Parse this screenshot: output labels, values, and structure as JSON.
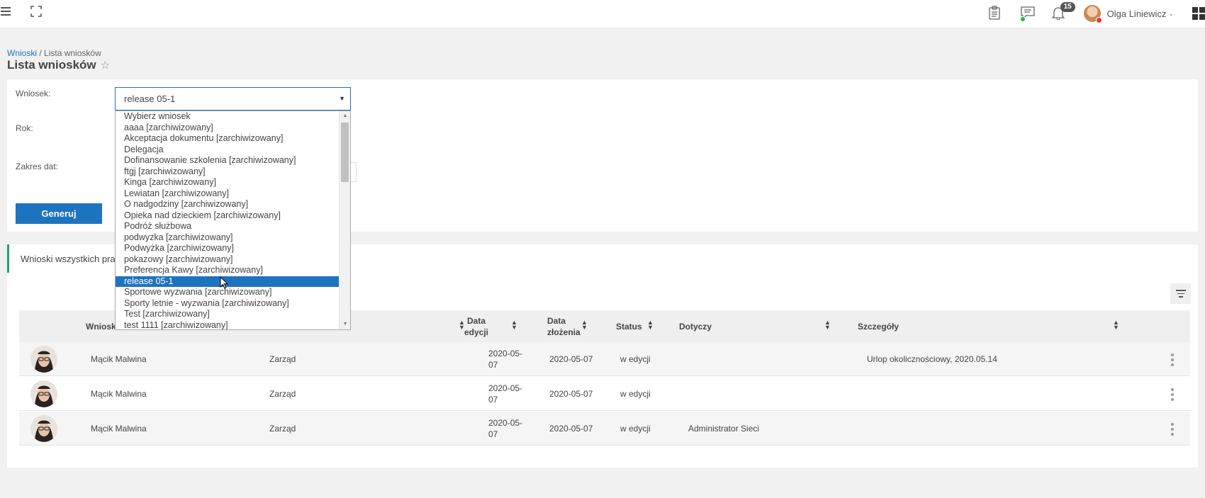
{
  "topbar": {
    "notification_count": "15",
    "user_name": "Olga Liniewicz"
  },
  "breadcrumb": {
    "root": "Wnioski",
    "separator": " / ",
    "current": "Lista wniosków"
  },
  "page_title": "Lista wniosków",
  "form": {
    "wniosek_label": "Wniosek:",
    "wniosek_value": "release 05-1",
    "rok_label": "Rok:",
    "zakres_label": "Zakres dat:",
    "generate_label": "Generuj"
  },
  "dropdown": {
    "options": [
      "Wybierz wniosek",
      "aaaa [zarchiwizowany]",
      "Akceptacja dokumentu [zarchiwizowany]",
      "Delegacja",
      "Dofinansowanie szkolenia [zarchiwizowany]",
      "ftgj [zarchiwizowany]",
      "Kinga [zarchiwizowany]",
      "Lewiatan [zarchiwizowany]",
      "O nadgodziny [zarchiwizowany]",
      "Opieka nad dzieckiem [zarchiwizowany]",
      "Podróż służbowa",
      "podwyzka [zarchiwizowany]",
      "Podwyżka [zarchiwizowany]",
      "pokazowy [zarchiwizowany]",
      "Preferencja Kawy [zarchiwizowany]",
      "release 05-1",
      "Sportowe wyzwania [zarchiwizowany]",
      "Sporty letnie - wyzwania [zarchiwizowany]",
      "Test [zarchiwizowany]",
      "test 1111 [zarchiwizowany]"
    ],
    "selected": "release 05-1"
  },
  "list": {
    "title": "Wnioski wszystkich prac",
    "columns": {
      "wnioskodawca": "Wniosk",
      "data_edycji_1": "Data",
      "data_edycji_2": "edycji",
      "data_zlozenia_1": "Data",
      "data_zlozenia_2": "złożenia",
      "status": "Status",
      "dotyczy": "Dotyczy",
      "szczegoly": "Szczegóły"
    },
    "rows": [
      {
        "name": "Mącik Malwina",
        "unit": "Zarząd",
        "edit_date_1": "2020-05-",
        "edit_date_2": "07",
        "submit_date": "2020-05-07",
        "status": "w edycji",
        "concerns": "",
        "details": "Urlop okolicznościowy, 2020.05.14"
      },
      {
        "name": "Mącik Malwina",
        "unit": "Zarząd",
        "edit_date_1": "2020-05-",
        "edit_date_2": "07",
        "submit_date": "2020-05-07",
        "status": "w edycji",
        "concerns": "",
        "details": ""
      },
      {
        "name": "Mącik Malwina",
        "unit": "Zarząd",
        "edit_date_1": "2020-05-",
        "edit_date_2": "07",
        "submit_date": "2020-05-07",
        "status": "w edycji",
        "concerns": "Administrator Sieci",
        "details": ""
      }
    ]
  },
  "colors": {
    "accent": "#1e73be",
    "green_accent": "#1aa37a"
  }
}
